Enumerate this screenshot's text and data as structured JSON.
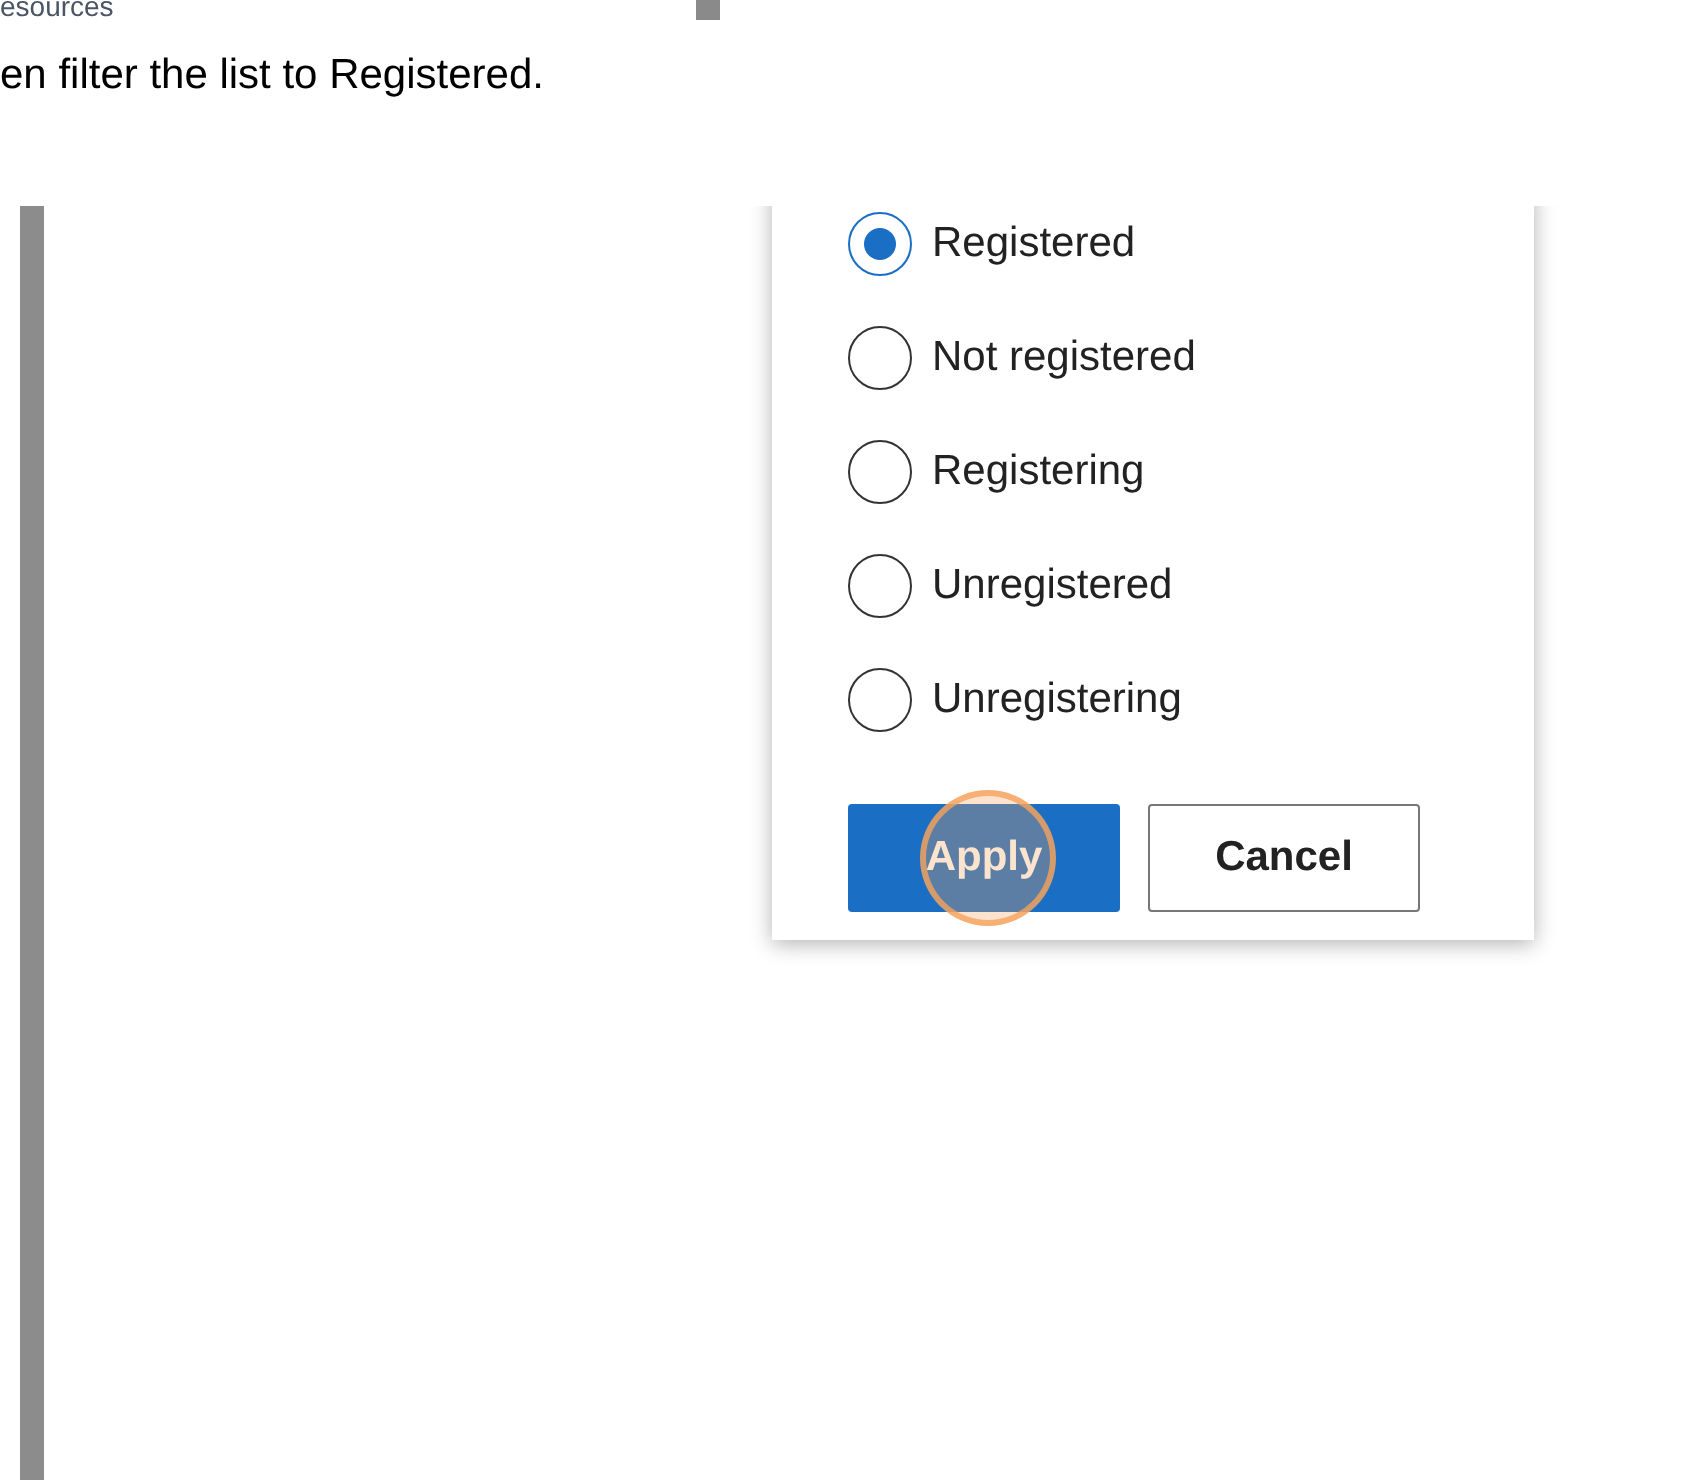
{
  "breadcrumb": "esources",
  "instruction": "en filter the list to Registered.",
  "filter_options": [
    {
      "label": "Registered",
      "selected": true
    },
    {
      "label": "Not registered",
      "selected": false
    },
    {
      "label": "Registering",
      "selected": false
    },
    {
      "label": "Unregistered",
      "selected": false
    },
    {
      "label": "Unregistering",
      "selected": false
    }
  ],
  "buttons": [
    {
      "label": "Apply",
      "kind": "primary",
      "clicked": true
    },
    {
      "label": "Cancel",
      "kind": "secondary",
      "clicked": false
    }
  ]
}
